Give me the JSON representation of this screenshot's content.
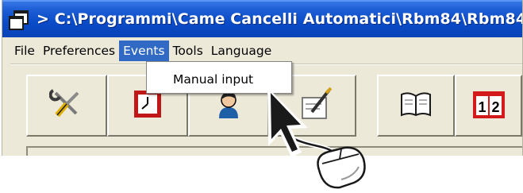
{
  "window": {
    "title": "> C:\\Programmi\\Came Cancelli Automatici\\Rbm84\\Rbm84",
    "app_icon": "windows-app-icon"
  },
  "menubar": {
    "items": [
      {
        "label": "File"
      },
      {
        "label": "Preferences"
      },
      {
        "label": "Events",
        "active": true
      },
      {
        "label": "Tools"
      },
      {
        "label": "Language"
      }
    ]
  },
  "events_menu": {
    "items": [
      {
        "label": "Manual input"
      }
    ]
  },
  "toolbar": {
    "buttons": [
      {
        "icon": "tools-icon"
      },
      {
        "icon": "clock-icon"
      },
      {
        "icon": "user-icon"
      },
      {
        "icon": "manual-input-icon"
      },
      {
        "icon": "book-icon"
      },
      {
        "icon": "calendar-icon"
      }
    ]
  },
  "calendar_icon_text": {
    "left": "1",
    "right": "2"
  },
  "overlay": {
    "pointer": "arrow-pointer-icon",
    "device": "mouse-icon"
  },
  "colors": {
    "titlebar": "#0a4bc8",
    "menu_highlight": "#316ac5",
    "window_bg": "#ece9d8"
  }
}
